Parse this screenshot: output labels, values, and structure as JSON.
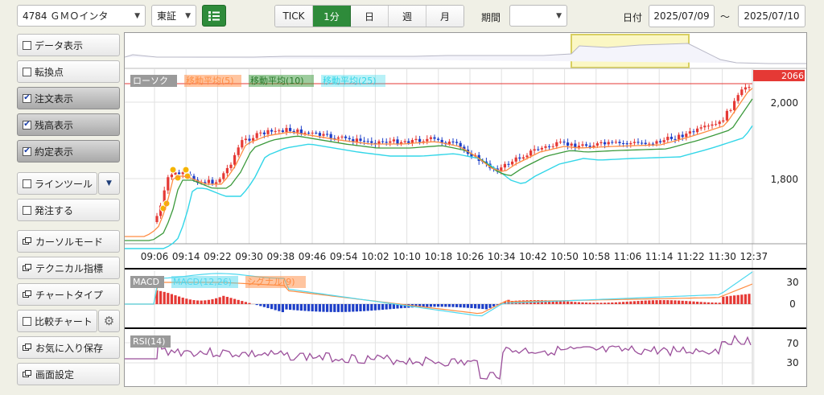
{
  "toolbar": {
    "stock_select": "4784 ＧＭＯインタ",
    "market_select": "東証",
    "period_tabs": [
      "TICK",
      "1分",
      "日",
      "週",
      "月"
    ],
    "active_tab": 1,
    "period_label": "期間",
    "period_select": "",
    "date_label": "日付",
    "date_from": "2025/07/09",
    "date_sep": "～",
    "date_to": "2025/07/10"
  },
  "sidebar": {
    "items": [
      {
        "label": "データ表示",
        "type": "checkbox",
        "checked": false
      },
      {
        "label": "転換点",
        "type": "checkbox",
        "checked": false
      },
      {
        "label": "注文表示",
        "type": "checkbox",
        "checked": true
      },
      {
        "label": "残高表示",
        "type": "checkbox",
        "checked": true
      },
      {
        "label": "約定表示",
        "type": "checkbox",
        "checked": true
      },
      {
        "label": "ラインツール",
        "type": "checkbox-dropdown",
        "checked": false
      },
      {
        "label": "発注する",
        "type": "checkbox",
        "checked": false
      },
      {
        "label": "カーソルモード",
        "type": "window"
      },
      {
        "label": "テクニカル指標",
        "type": "window"
      },
      {
        "label": "チャートタイプ",
        "type": "window"
      },
      {
        "label": "比較チャート",
        "type": "checkbox-gear",
        "checked": false
      },
      {
        "label": "お気に入り保存",
        "type": "window"
      },
      {
        "label": "画面設定",
        "type": "window"
      }
    ]
  },
  "chart": {
    "price_legend": [
      "ローソク",
      "移動平均(5)",
      "移動平均(10)",
      "移動平均(25)"
    ],
    "current_price_label": "2066",
    "y_ticks": [
      "2,000",
      "1,800"
    ],
    "x_ticks": [
      "09:06",
      "09:14",
      "09:22",
      "09:30",
      "09:38",
      "09:46",
      "09:54",
      "10:02",
      "10:10",
      "10:18",
      "10:26",
      "10:34",
      "10:42",
      "10:50",
      "10:58",
      "11:06",
      "11:14",
      "11:22",
      "11:30",
      "12:37"
    ],
    "macd_legend": [
      "MACD",
      "MACD(12,26)",
      "シグナル(9)"
    ],
    "macd_ticks": [
      "30",
      "0"
    ],
    "rsi_legend": [
      "RSI(14)"
    ],
    "rsi_ticks": [
      "70",
      "30"
    ]
  },
  "colors": {
    "accent_green": "#2e8b3a",
    "candle_up": "#e53935",
    "candle_down": "#1e3fc8",
    "ma5": "#ff8c42",
    "ma10": "#3c9a3c",
    "ma25": "#33d6e8",
    "macd_line": "#4fd8ee",
    "signal_line": "#ff8c42",
    "rsi_line": "#9b4f9b",
    "price_line": "#e53935"
  },
  "icons": {
    "list_icon": "list-icon",
    "gear_icon": "gear-icon",
    "window_icon": "window-icon",
    "dropdown_icon": "chevron-down-icon"
  }
}
